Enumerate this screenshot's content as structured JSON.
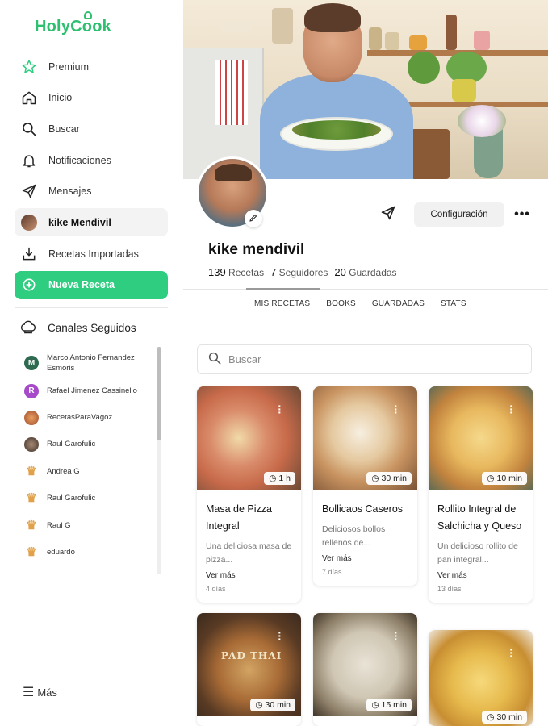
{
  "app": {
    "logo": "HolyCook",
    "brand_color": "#2fcd80"
  },
  "sidebar": {
    "items": [
      {
        "label": "Premium",
        "icon": "star-icon"
      },
      {
        "label": "Inicio",
        "icon": "home-icon"
      },
      {
        "label": "Buscar",
        "icon": "search-icon"
      },
      {
        "label": "Notificaciones",
        "icon": "bell-icon"
      },
      {
        "label": "Mensajes",
        "icon": "send-icon"
      },
      {
        "label": "kike Mendivil",
        "icon": "avatar"
      },
      {
        "label": "Recetas Importadas",
        "icon": "import-icon"
      },
      {
        "label": "Nueva Receta",
        "icon": "plus-circle-icon"
      }
    ],
    "channels_title": "Canales Seguidos",
    "channels": [
      {
        "name": "Marco Antonio Fernandez",
        "name2": "Esmoris",
        "initial": "M",
        "color": "#2d6a4f"
      },
      {
        "name": "Rafael Jimenez Cassinello",
        "initial": "R",
        "color": "#a64ac9"
      },
      {
        "name": "RecetasParaVagoz",
        "initial": "",
        "color": "#c1693f"
      },
      {
        "name": "Raul Garofulic",
        "initial": "",
        "color": "#5a4a3f"
      },
      {
        "name": "Andrea G",
        "initial": "",
        "color": "#e0a14a"
      },
      {
        "name": "Raul Garofulic",
        "initial": "",
        "color": "#e0a14a"
      },
      {
        "name": "Raul G",
        "initial": "",
        "color": "#e0a14a"
      },
      {
        "name": "eduardo",
        "initial": "",
        "color": "#e0a14a"
      }
    ],
    "more": "Más"
  },
  "profile": {
    "username": "kike mendivil",
    "recipes_count": "139",
    "recipes_label": "Recetas",
    "followers_count": "7",
    "followers_label": "Seguidores",
    "saved_count": "20",
    "saved_label": "Guardadas",
    "config_button": "Configuración"
  },
  "tabs": [
    "MIS RECETAS",
    "BOOKS",
    "GUARDADAS",
    "STATS"
  ],
  "search": {
    "placeholder": "Buscar"
  },
  "recipes": [
    {
      "title": "Masa de Pizza Integral",
      "time": "1 h",
      "desc": "Una deliciosa masa de pizza...",
      "more": "Ver más",
      "ago": "4 días"
    },
    {
      "title": "Bollicaos Caseros",
      "time": "30 min",
      "desc": "Deliciosos bollos rellenos de...",
      "more": "Ver más",
      "ago": "7 días"
    },
    {
      "title": "Rollito Integral de Salchicha y Queso",
      "time": "10 min",
      "desc": "Un delicioso rollito de pan integral...",
      "more": "Ver más",
      "ago": "13 días"
    },
    {
      "time": "30 min",
      "overlay_text": "PAD THAI"
    },
    {
      "time": "15 min"
    },
    {
      "time": "30 min"
    }
  ]
}
